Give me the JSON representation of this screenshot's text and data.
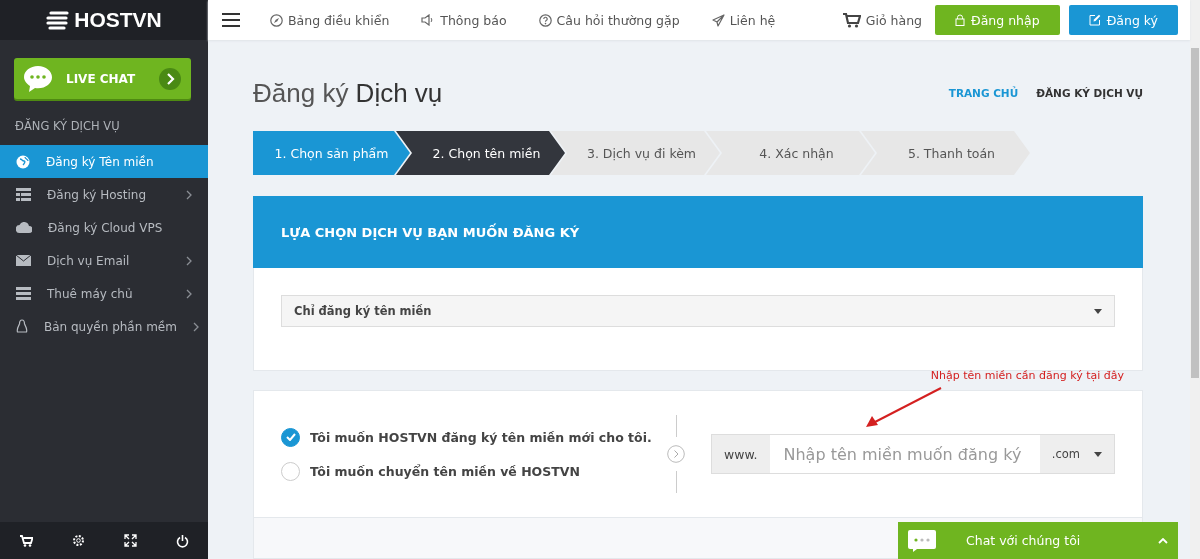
{
  "brand": {
    "name": "HOSTVN"
  },
  "sidebar": {
    "live_chat": "LIVE CHAT",
    "section_title": "ĐĂNG KÝ DỊCH VỤ",
    "items": [
      {
        "label": "Đăng ký Tên miền",
        "selected": true,
        "has_submenu": false
      },
      {
        "label": "Đăng ký Hosting",
        "selected": false,
        "has_submenu": true
      },
      {
        "label": "Đăng ký Cloud VPS",
        "selected": false,
        "has_submenu": false
      },
      {
        "label": "Dịch vụ Email",
        "selected": false,
        "has_submenu": true
      },
      {
        "label": "Thuê máy chủ",
        "selected": false,
        "has_submenu": true
      },
      {
        "label": "Bản quyền phần mềm",
        "selected": false,
        "has_submenu": true
      }
    ]
  },
  "top_nav": {
    "links": [
      "Bảng điều khiển",
      "Thông báo",
      "Câu hỏi thường gặp",
      "Liên hệ"
    ],
    "cart": "Giỏ hàng",
    "login": "Đăng nhập",
    "register": "Đăng ký"
  },
  "page": {
    "title_light": "Đăng ký",
    "title_bold": "Dịch vụ",
    "breadcrumb": [
      {
        "label": "TRANG CHỦ",
        "selected": false
      },
      {
        "label": "ĐĂNG KÝ DỊCH VỤ",
        "selected": true
      }
    ]
  },
  "steps": [
    {
      "label": "1. Chọn sản phẩm",
      "completed": true,
      "selected": false
    },
    {
      "label": "2. Chọn tên miền",
      "completed": false,
      "selected": true
    },
    {
      "label": "3. Dịch vụ đi kèm",
      "completed": false,
      "selected": false
    },
    {
      "label": "4. Xác nhận",
      "completed": false,
      "selected": false
    },
    {
      "label": "5. Thanh toán",
      "completed": false,
      "selected": false
    }
  ],
  "service_card": {
    "title": "LỰA CHỌN DỊCH VỤ BẠN MUỐN ĐĂNG KÝ",
    "select_value": "Chỉ đăng ký tên miền"
  },
  "domain_card": {
    "options": [
      {
        "label": "Tôi muốn HOSTVN đăng ký tên miền mới cho tôi.",
        "selected": true
      },
      {
        "label": "Tôi muốn chuyển tên miền về HOSTVN",
        "selected": false
      }
    ],
    "prefix": "www.",
    "placeholder": "Nhập tên miền muốn đăng ký",
    "tld": ".com",
    "annotation": "Nhập tên miền cần đăng ký tại đây"
  },
  "chat_widget": {
    "label": "Chat với chúng tôi"
  }
}
